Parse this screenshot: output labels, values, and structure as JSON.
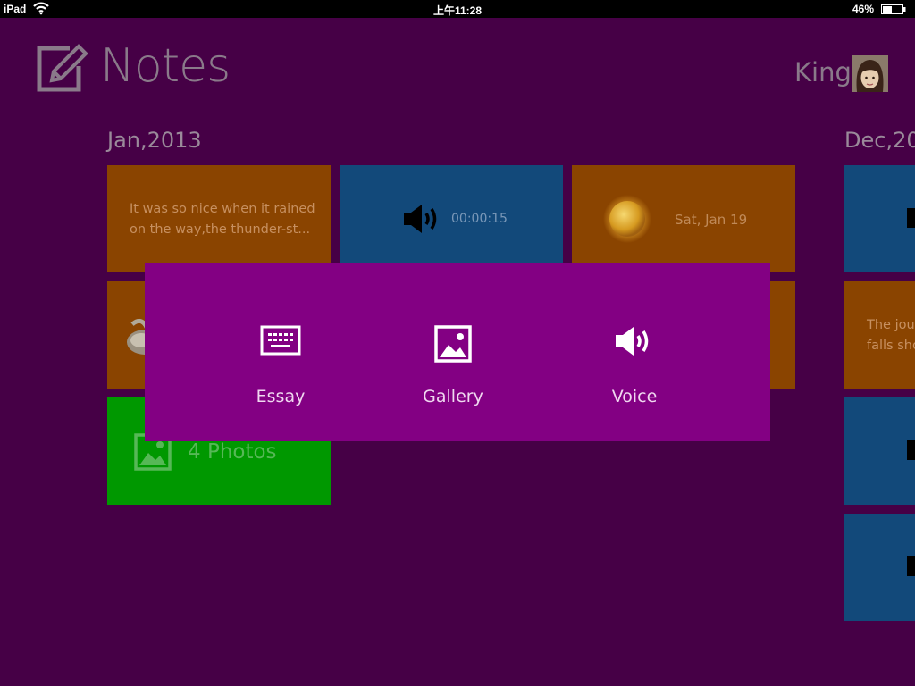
{
  "status_bar": {
    "device": "iPad",
    "time": "上午11:28",
    "battery": "46%"
  },
  "header": {
    "app_title": "Notes",
    "user_name": "King"
  },
  "groups": [
    {
      "title": "Jan,2013",
      "tiles": [
        {
          "type": "text",
          "text": "It was so nice when it rained on the way,the thunder-st..."
        },
        {
          "type": "voice",
          "duration": "00:00:15"
        },
        {
          "type": "weather",
          "date": "Sat, Jan 19"
        },
        {
          "type": "photos",
          "label": "4 Photos"
        }
      ]
    },
    {
      "title": "Dec,20",
      "tiles": [
        {
          "type": "text",
          "text": "The jou\nfalls sho"
        }
      ]
    }
  ],
  "popup": {
    "options": [
      {
        "label": "Essay",
        "icon": "keyboard-icon"
      },
      {
        "label": "Gallery",
        "icon": "image-icon"
      },
      {
        "label": "Voice",
        "icon": "speaker-icon"
      }
    ]
  },
  "colors": {
    "background": "#420042",
    "popup": "#830083",
    "tile_orange": "#8a4400",
    "tile_blue": "#12497a",
    "tile_green": "#009800"
  }
}
